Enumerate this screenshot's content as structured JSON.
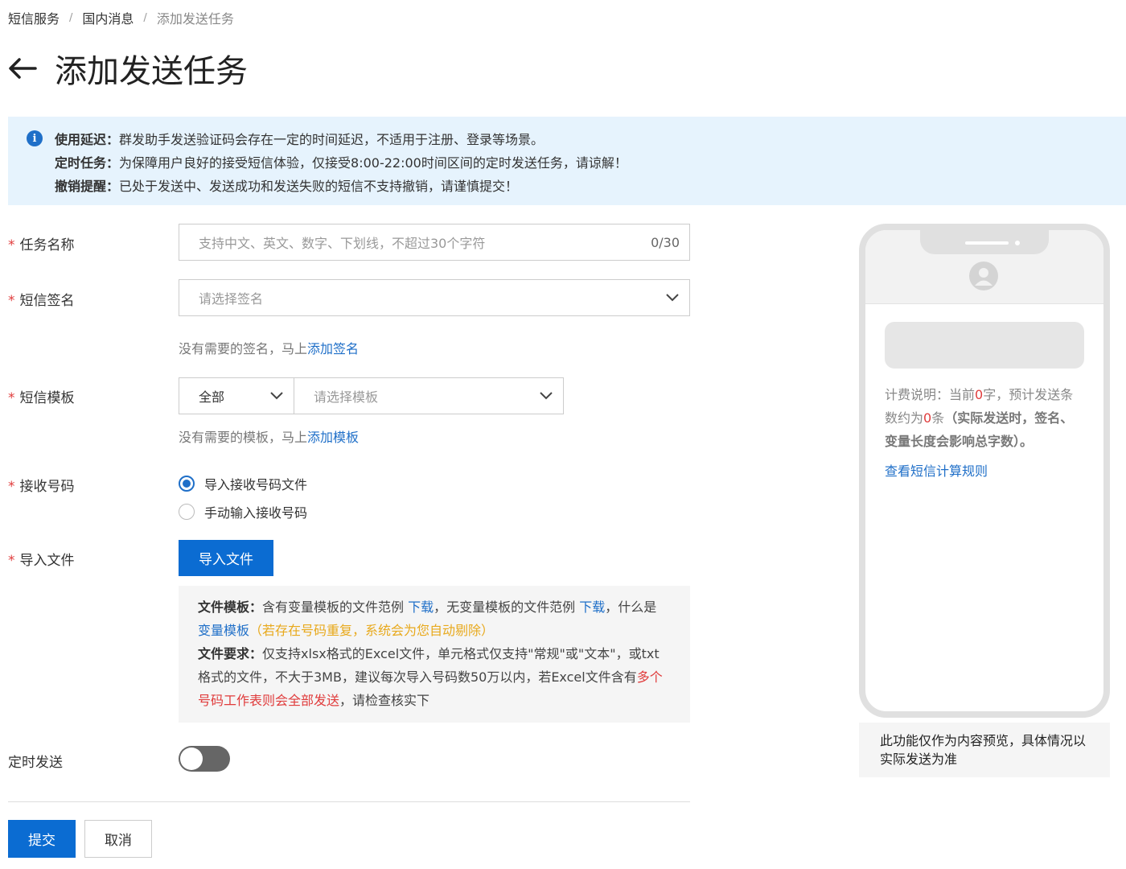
{
  "breadcrumb": {
    "items": [
      "短信服务",
      "国内消息",
      "添加发送任务"
    ],
    "separator": "/"
  },
  "page": {
    "title": "添加发送任务"
  },
  "notice": {
    "lines": [
      {
        "label": "使用延迟：",
        "text": "群发助手发送验证码会存在一定的时间延迟，不适用于注册、登录等场景。"
      },
      {
        "label": "定时任务：",
        "text": "为保障用户良好的接受短信体验，仅接受8:00-22:00时间区间的定时发送任务，请谅解！"
      },
      {
        "label": "撤销提醒：",
        "text": "已处于发送中、发送成功和发送失败的短信不支持撤销，请谨慎提交！"
      }
    ]
  },
  "form": {
    "required_mark": "*",
    "task_name": {
      "label": "任务名称",
      "placeholder": "支持中文、英文、数字、下划线，不超过30个字符",
      "counter": "0/30"
    },
    "signature": {
      "label": "短信签名",
      "placeholder": "请选择签名",
      "hint_prefix": "没有需要的签名，马上",
      "hint_link": "添加签名"
    },
    "template": {
      "label": "短信模板",
      "category": "全部",
      "placeholder": "请选择模板",
      "hint_prefix": "没有需要的模板，马上",
      "hint_link": "添加模板"
    },
    "recipients": {
      "label": "接收号码",
      "options": [
        "导入接收号码文件",
        "手动输入接收号码"
      ],
      "selected_index": 0
    },
    "import_file": {
      "label": "导入文件",
      "button": "导入文件",
      "info": {
        "template_label": "文件模板",
        "colon": "：",
        "t1": "含有变量模板的文件范例 ",
        "download1": "下载",
        "t2": "，无变量模板的文件范例 ",
        "download2": "下载",
        "t3": "，什么是 ",
        "variable_link": "变量模板",
        "warn": "（若存在号码重复，系统会为您自动剔除）",
        "require_label": "文件要求",
        "r1": "仅支持xlsx格式的Excel文件，单元格式仅支持\"常规\"或\"文本\"，或txt格式的文件，不大于3MB，建议每次导入号码数50万以内，若Excel文件含有",
        "r_red": "多个号码工作表则会全部发送",
        "r2": "，请检查核实下"
      }
    },
    "schedule": {
      "label": "定时发送",
      "enabled": false
    }
  },
  "actions": {
    "submit": "提交",
    "cancel": "取消"
  },
  "preview": {
    "bill_prefix": "计费说明：当前",
    "char_count": "0",
    "bill_mid1": "字，预计发送条数约为",
    "msg_count": "0",
    "bill_mid2": "条",
    "bill_bold": "（实际发送时，签名、变量长度会影响总字数）。",
    "rule_link": "查看短信计算规则",
    "note": "此功能仅作为内容预览，具体情况以实际发送为准"
  },
  "colors": {
    "primary": "#0b6cd2",
    "link": "#1f6fc8",
    "required": "#e03c3c",
    "warning": "#e8a91c",
    "notice_bg": "#e6f3fd"
  }
}
